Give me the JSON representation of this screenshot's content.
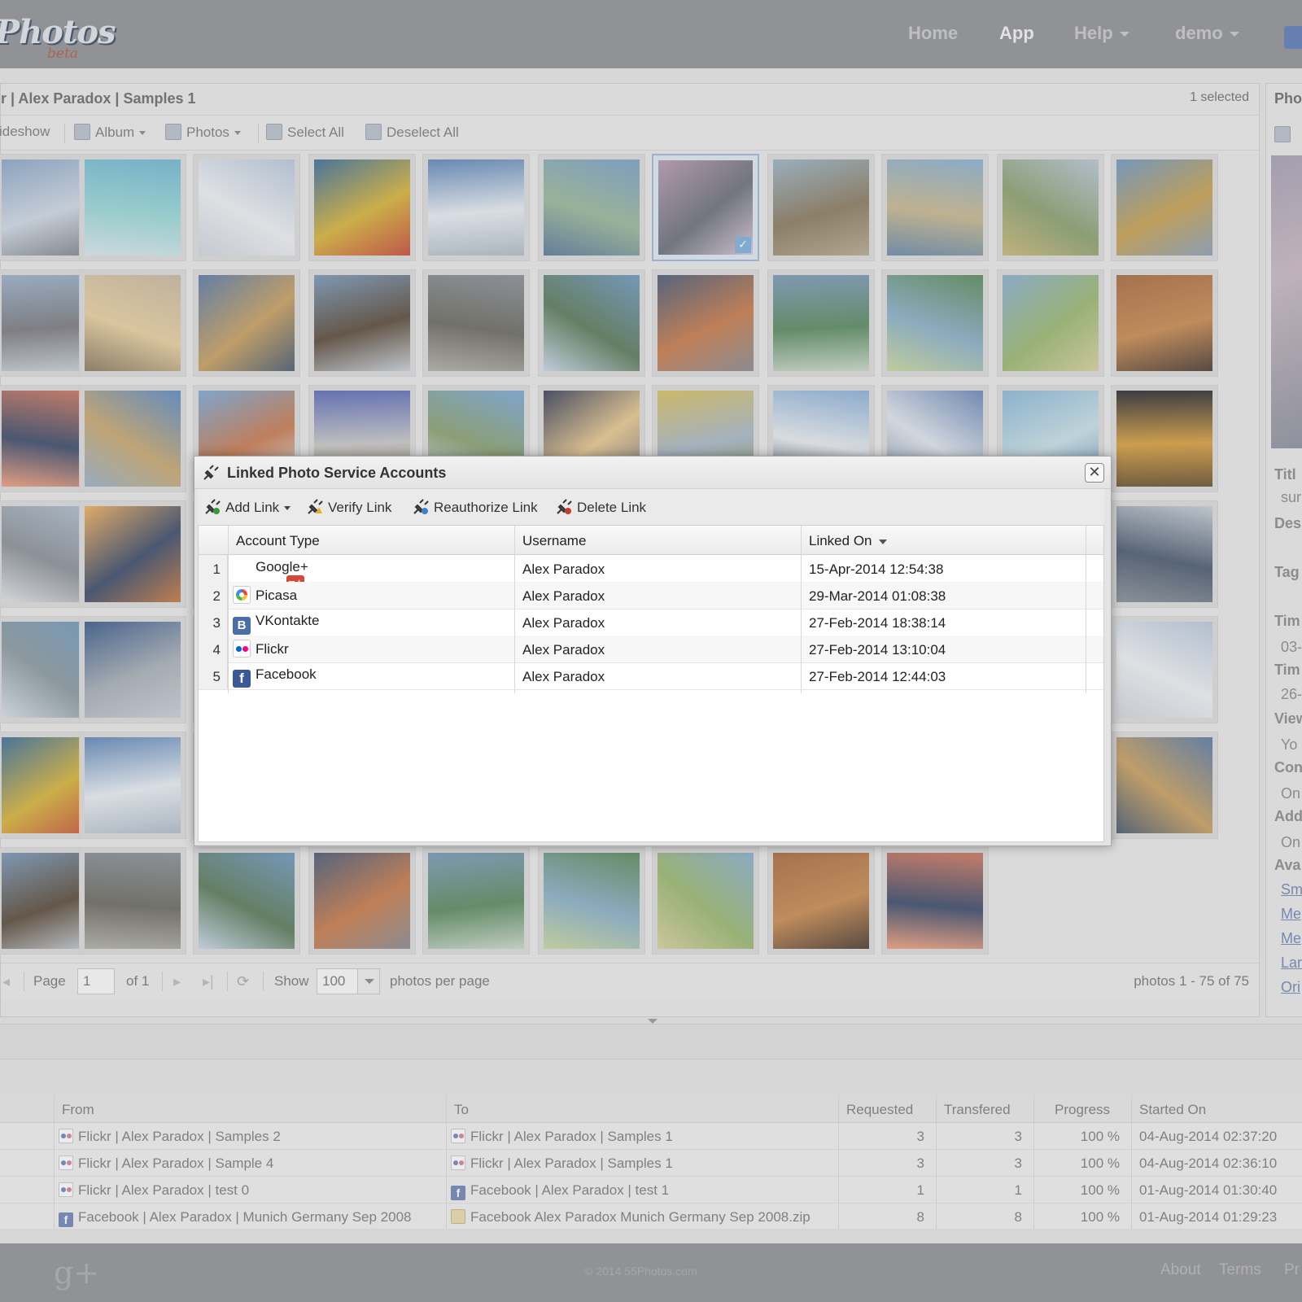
{
  "header": {
    "logo_text": "Photos",
    "logo_sub": "beta",
    "nav": [
      {
        "label": "Home"
      },
      {
        "label": "App"
      },
      {
        "label": "Help"
      },
      {
        "label": "demo"
      }
    ]
  },
  "photo_panel": {
    "title": "r | Alex Paradox | Samples 1",
    "selected": "1 selected",
    "toolbar": {
      "slideshow": "ideshow",
      "album": "Album",
      "photos": "Photos",
      "select_all": "Select All",
      "deselect_all": "Deselect All"
    },
    "pager": {
      "page_label": "Page",
      "page_value": "1",
      "of_label": "of 1",
      "show_label": "Show",
      "per_page_value": "100",
      "per_page_suffix": "photos per page",
      "summary": "photos 1 - 75 of 75"
    }
  },
  "details_panel": {
    "title": "Pho",
    "labels": [
      "Titl",
      "Des",
      "Tag",
      "Tim",
      "Tim",
      "View",
      "Con",
      "Add",
      "Ava"
    ],
    "values": [
      "sur",
      "03-",
      "26-",
      "Yo",
      "On",
      "On"
    ],
    "links": [
      "Sm",
      "Me",
      "Me",
      "Lar",
      "Ori"
    ]
  },
  "dialog": {
    "title": "Linked Photo Service Accounts",
    "close_symbol": "✕",
    "toolbar": {
      "add": "Add Link",
      "verify": "Verify Link",
      "reauthorize": "Reauthorize Link",
      "delete": "Delete Link"
    },
    "columns": {
      "account_type": "Account Type",
      "username": "Username",
      "linked_on": "Linked On"
    },
    "rows": [
      {
        "num": "1",
        "type": "Google+",
        "icon": "google-plus-icon",
        "username": "Alex Paradox",
        "linked": "15-Apr-2014 12:54:38"
      },
      {
        "num": "2",
        "type": "Picasa",
        "icon": "picasa-icon",
        "username": "Alex Paradox",
        "linked": "29-Mar-2014 01:08:38"
      },
      {
        "num": "3",
        "type": "VKontakte",
        "icon": "vkontakte-icon",
        "username": "Alex Paradox",
        "linked": "27-Feb-2014 18:38:14"
      },
      {
        "num": "4",
        "type": "Flickr",
        "icon": "flickr-icon",
        "username": "Alex Paradox",
        "linked": "27-Feb-2014 13:10:04"
      },
      {
        "num": "5",
        "type": "Facebook",
        "icon": "facebook-icon",
        "username": "Alex Paradox",
        "linked": "27-Feb-2014 12:44:03"
      }
    ]
  },
  "transfers": {
    "columns": {
      "from": "From",
      "to": "To",
      "requested": "Requested",
      "transfered": "Transfered",
      "progress": "Progress",
      "started": "Started On"
    },
    "rows": [
      {
        "from": "Flickr | Alex Paradox | Samples 2",
        "from_icon": "flickr",
        "to": "Flickr | Alex Paradox | Samples 1",
        "to_icon": "flickr",
        "requested": "3",
        "transfered": "3",
        "progress": "100 %",
        "started": "04-Aug-2014 02:37:20"
      },
      {
        "from": "Flickr | Alex Paradox | Sample 4",
        "from_icon": "flickr",
        "to": "Flickr | Alex Paradox | Samples 1",
        "to_icon": "flickr",
        "requested": "3",
        "transfered": "3",
        "progress": "100 %",
        "started": "04-Aug-2014 02:36:10"
      },
      {
        "from": "Flickr | Alex Paradox | test 0",
        "from_icon": "flickr",
        "to": "Facebook | Alex Paradox | test 1",
        "to_icon": "facebook",
        "requested": "1",
        "transfered": "1",
        "progress": "100 %",
        "started": "01-Aug-2014 01:30:40"
      },
      {
        "from": "Facebook | Alex Paradox | Munich Germany Sep 2008",
        "from_icon": "facebook",
        "to": "Facebook Alex Paradox Munich Germany Sep 2008.zip",
        "to_icon": "zip",
        "requested": "8",
        "transfered": "8",
        "progress": "100 %",
        "started": "01-Aug-2014 01:29:23"
      }
    ]
  },
  "footer": {
    "copyright": "© 2014 55Photos.com",
    "links": [
      "About",
      "Terms",
      "Pr"
    ]
  }
}
